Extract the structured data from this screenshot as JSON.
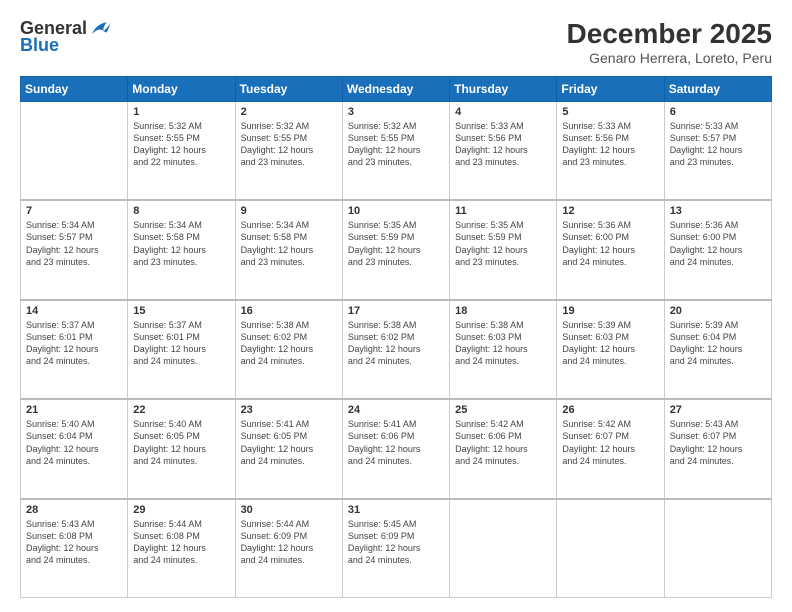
{
  "header": {
    "logo": {
      "line1": "General",
      "line2": "Blue"
    },
    "month": "December 2025",
    "location": "Genaro Herrera, Loreto, Peru"
  },
  "weekdays": [
    "Sunday",
    "Monday",
    "Tuesday",
    "Wednesday",
    "Thursday",
    "Friday",
    "Saturday"
  ],
  "weeks": [
    [
      {
        "day": "",
        "info": ""
      },
      {
        "day": "1",
        "info": "Sunrise: 5:32 AM\nSunset: 5:55 PM\nDaylight: 12 hours\nand 22 minutes."
      },
      {
        "day": "2",
        "info": "Sunrise: 5:32 AM\nSunset: 5:55 PM\nDaylight: 12 hours\nand 23 minutes."
      },
      {
        "day": "3",
        "info": "Sunrise: 5:32 AM\nSunset: 5:55 PM\nDaylight: 12 hours\nand 23 minutes."
      },
      {
        "day": "4",
        "info": "Sunrise: 5:33 AM\nSunset: 5:56 PM\nDaylight: 12 hours\nand 23 minutes."
      },
      {
        "day": "5",
        "info": "Sunrise: 5:33 AM\nSunset: 5:56 PM\nDaylight: 12 hours\nand 23 minutes."
      },
      {
        "day": "6",
        "info": "Sunrise: 5:33 AM\nSunset: 5:57 PM\nDaylight: 12 hours\nand 23 minutes."
      }
    ],
    [
      {
        "day": "7",
        "info": "Sunrise: 5:34 AM\nSunset: 5:57 PM\nDaylight: 12 hours\nand 23 minutes."
      },
      {
        "day": "8",
        "info": "Sunrise: 5:34 AM\nSunset: 5:58 PM\nDaylight: 12 hours\nand 23 minutes."
      },
      {
        "day": "9",
        "info": "Sunrise: 5:34 AM\nSunset: 5:58 PM\nDaylight: 12 hours\nand 23 minutes."
      },
      {
        "day": "10",
        "info": "Sunrise: 5:35 AM\nSunset: 5:59 PM\nDaylight: 12 hours\nand 23 minutes."
      },
      {
        "day": "11",
        "info": "Sunrise: 5:35 AM\nSunset: 5:59 PM\nDaylight: 12 hours\nand 23 minutes."
      },
      {
        "day": "12",
        "info": "Sunrise: 5:36 AM\nSunset: 6:00 PM\nDaylight: 12 hours\nand 24 minutes."
      },
      {
        "day": "13",
        "info": "Sunrise: 5:36 AM\nSunset: 6:00 PM\nDaylight: 12 hours\nand 24 minutes."
      }
    ],
    [
      {
        "day": "14",
        "info": "Sunrise: 5:37 AM\nSunset: 6:01 PM\nDaylight: 12 hours\nand 24 minutes."
      },
      {
        "day": "15",
        "info": "Sunrise: 5:37 AM\nSunset: 6:01 PM\nDaylight: 12 hours\nand 24 minutes."
      },
      {
        "day": "16",
        "info": "Sunrise: 5:38 AM\nSunset: 6:02 PM\nDaylight: 12 hours\nand 24 minutes."
      },
      {
        "day": "17",
        "info": "Sunrise: 5:38 AM\nSunset: 6:02 PM\nDaylight: 12 hours\nand 24 minutes."
      },
      {
        "day": "18",
        "info": "Sunrise: 5:38 AM\nSunset: 6:03 PM\nDaylight: 12 hours\nand 24 minutes."
      },
      {
        "day": "19",
        "info": "Sunrise: 5:39 AM\nSunset: 6:03 PM\nDaylight: 12 hours\nand 24 minutes."
      },
      {
        "day": "20",
        "info": "Sunrise: 5:39 AM\nSunset: 6:04 PM\nDaylight: 12 hours\nand 24 minutes."
      }
    ],
    [
      {
        "day": "21",
        "info": "Sunrise: 5:40 AM\nSunset: 6:04 PM\nDaylight: 12 hours\nand 24 minutes."
      },
      {
        "day": "22",
        "info": "Sunrise: 5:40 AM\nSunset: 6:05 PM\nDaylight: 12 hours\nand 24 minutes."
      },
      {
        "day": "23",
        "info": "Sunrise: 5:41 AM\nSunset: 6:05 PM\nDaylight: 12 hours\nand 24 minutes."
      },
      {
        "day": "24",
        "info": "Sunrise: 5:41 AM\nSunset: 6:06 PM\nDaylight: 12 hours\nand 24 minutes."
      },
      {
        "day": "25",
        "info": "Sunrise: 5:42 AM\nSunset: 6:06 PM\nDaylight: 12 hours\nand 24 minutes."
      },
      {
        "day": "26",
        "info": "Sunrise: 5:42 AM\nSunset: 6:07 PM\nDaylight: 12 hours\nand 24 minutes."
      },
      {
        "day": "27",
        "info": "Sunrise: 5:43 AM\nSunset: 6:07 PM\nDaylight: 12 hours\nand 24 minutes."
      }
    ],
    [
      {
        "day": "28",
        "info": "Sunrise: 5:43 AM\nSunset: 6:08 PM\nDaylight: 12 hours\nand 24 minutes."
      },
      {
        "day": "29",
        "info": "Sunrise: 5:44 AM\nSunset: 6:08 PM\nDaylight: 12 hours\nand 24 minutes."
      },
      {
        "day": "30",
        "info": "Sunrise: 5:44 AM\nSunset: 6:09 PM\nDaylight: 12 hours\nand 24 minutes."
      },
      {
        "day": "31",
        "info": "Sunrise: 5:45 AM\nSunset: 6:09 PM\nDaylight: 12 hours\nand 24 minutes."
      },
      {
        "day": "",
        "info": ""
      },
      {
        "day": "",
        "info": ""
      },
      {
        "day": "",
        "info": ""
      }
    ]
  ]
}
